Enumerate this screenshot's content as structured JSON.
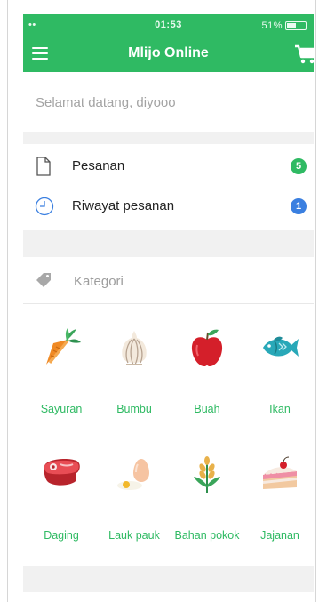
{
  "status_bar": {
    "time": "01:53",
    "battery": "51%",
    "signal": "••"
  },
  "header": {
    "title": "Mlijo Online",
    "background": "#2fba63"
  },
  "welcome": {
    "text": "Selamat datang, diyooo"
  },
  "menu": [
    {
      "label": "Pesanan",
      "badge": "5",
      "badge_color": "#2fba63",
      "icon": "document-icon"
    },
    {
      "label": "Riwayat pesanan",
      "badge": "1",
      "badge_color": "#3a7fe0",
      "icon": "clock-icon"
    }
  ],
  "categories_header": {
    "label": "Kategori",
    "icon": "tag-icon"
  },
  "categories": [
    {
      "label": "Sayuran",
      "icon": "carrot-icon"
    },
    {
      "label": "Bumbu",
      "icon": "garlic-icon"
    },
    {
      "label": "Buah",
      "icon": "apple-icon"
    },
    {
      "label": "Ikan",
      "icon": "fish-icon"
    },
    {
      "label": "Daging",
      "icon": "meat-icon"
    },
    {
      "label": "Lauk pauk",
      "icon": "egg-icon"
    },
    {
      "label": "Bahan pokok",
      "icon": "wheat-icon"
    },
    {
      "label": "Jajanan",
      "icon": "cake-icon"
    }
  ]
}
